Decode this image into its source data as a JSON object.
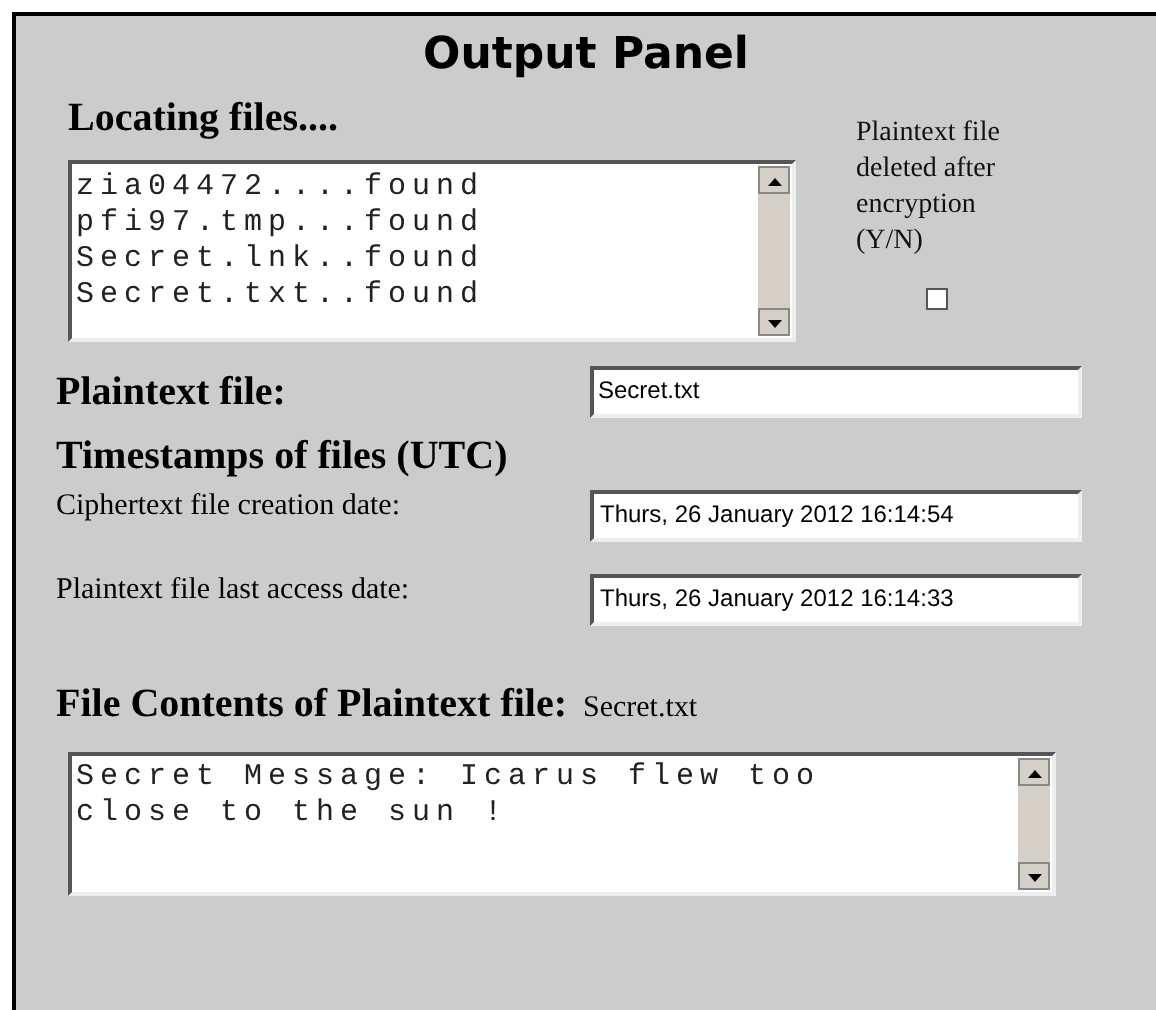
{
  "title": "Output Panel",
  "locating": {
    "heading": "Locating files....",
    "lines": [
      "zia04472....found",
      "pfi97.tmp...found",
      "Secret.lnk..found",
      "Secret.txt..found"
    ]
  },
  "deleted": {
    "label": "Plaintext file deleted after encryption (Y/N)",
    "checked": false
  },
  "plaintext": {
    "label": "Plaintext file:",
    "value": "Secret.txt"
  },
  "timestamps": {
    "heading": "Timestamps of files (UTC)",
    "rows": [
      {
        "label": "Ciphertext file creation date:",
        "value": "Thurs, 26 January 2012 16:14:54"
      },
      {
        "label": "Plaintext file last access date:",
        "value": "Thurs, 26 January 2012 16:14:33"
      }
    ]
  },
  "contents": {
    "heading": "File Contents of Plaintext file:",
    "file": "Secret.txt",
    "text": "Secret Message: Icarus flew too close to the sun !"
  }
}
